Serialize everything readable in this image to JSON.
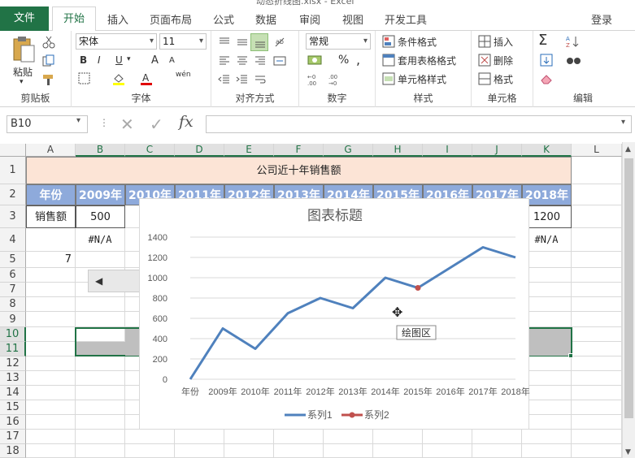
{
  "window": {
    "title": "动态折线图.xlsx - Excel"
  },
  "tabs": {
    "file": "文件",
    "home": "开始",
    "insert": "插入",
    "layout": "页面布局",
    "formulas": "公式",
    "data": "数据",
    "review": "审阅",
    "view": "视图",
    "developer": "开发工具",
    "login": "登录"
  },
  "ribbon": {
    "clipboard": {
      "label": "剪贴板",
      "paste": "粘贴"
    },
    "font": {
      "label": "字体",
      "name": "宋体",
      "size": "11",
      "bold": "B",
      "italic": "I",
      "underline": "U",
      "grow": "A",
      "shrink": "A",
      "phonetic": "wén"
    },
    "alignment": {
      "label": "对齐方式"
    },
    "number": {
      "label": "数字",
      "format": "常规",
      "percent": "%",
      "comma": ","
    },
    "styles": {
      "label": "样式",
      "conditional": "条件格式",
      "table": "套用表格格式",
      "cell": "单元格样式"
    },
    "cells": {
      "label": "单元格",
      "insert": "插入",
      "delete": "删除",
      "format": "格式"
    },
    "editing": {
      "label": "编辑"
    },
    "colors": {
      "accent": "#217346"
    }
  },
  "formula_bar": {
    "name_box": "B10",
    "value": ""
  },
  "sheet": {
    "columns": [
      "A",
      "B",
      "C",
      "D",
      "E",
      "F",
      "G",
      "H",
      "I",
      "J",
      "K",
      "L"
    ],
    "rows": [
      "1",
      "2",
      "3",
      "4",
      "5",
      "6",
      "7",
      "8",
      "9",
      "10",
      "11",
      "12",
      "13",
      "14",
      "15",
      "16",
      "17",
      "18"
    ],
    "title": "公司近十年销售额",
    "header_label": "年份",
    "years": [
      "2009年",
      "2010年",
      "2011年",
      "2012年",
      "2013年",
      "2014年",
      "2015年",
      "2016年",
      "2017年",
      "2018年"
    ],
    "sales_label": "销售额",
    "b3": "500",
    "k3": "1200",
    "b4": "#N/A",
    "k4": "#N/A",
    "a5": "7"
  },
  "chart_data": {
    "type": "line",
    "title": "图表标题",
    "categories": [
      "年份",
      "2009年",
      "2010年",
      "2011年",
      "2012年",
      "2013年",
      "2014年",
      "2015年",
      "2016年",
      "2017年",
      "2018年"
    ],
    "series": [
      {
        "name": "系列1",
        "values": [
          0,
          500,
          300,
          650,
          800,
          700,
          1000,
          900,
          1100,
          1300,
          1200
        ],
        "color": "#4f81bd"
      },
      {
        "name": "系列2",
        "values": [
          null,
          null,
          null,
          null,
          null,
          null,
          null,
          900,
          null,
          null,
          null
        ],
        "color": "#c0504d"
      }
    ],
    "ylim": [
      0,
      1400
    ],
    "yticks": [
      "0",
      "200",
      "400",
      "600",
      "800",
      "1000",
      "1200",
      "1400"
    ],
    "grid": true,
    "legend": "bottom",
    "tooltip": "绘图区"
  }
}
